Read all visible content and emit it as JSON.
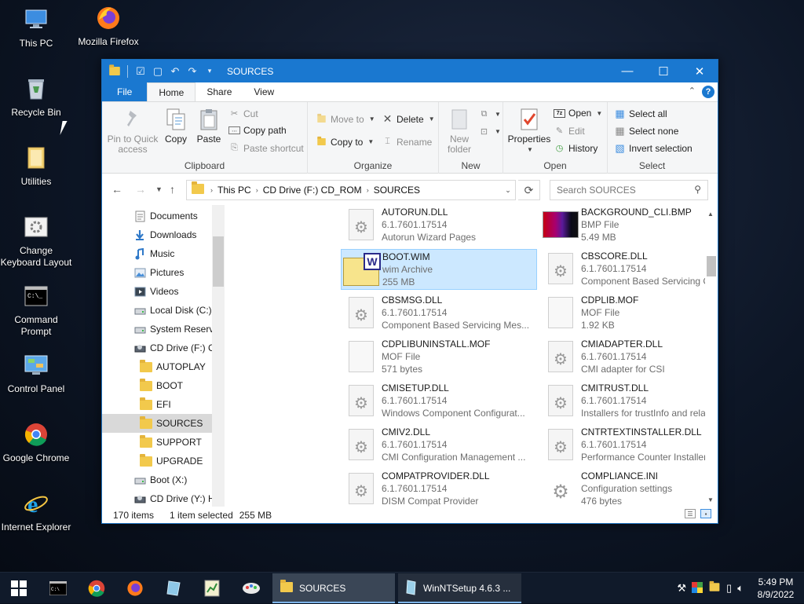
{
  "desktop": {
    "icons": [
      {
        "label": "This PC",
        "icon": "computer-icon"
      },
      {
        "label": "Mozilla Firefox",
        "icon": "firefox-icon"
      },
      {
        "label": "Recycle Bin",
        "icon": "recycle-bin-icon"
      },
      {
        "label": "Utilities",
        "icon": "folder-icon"
      },
      {
        "label": "Change Keyboard Layout",
        "icon": "keyboard-settings-icon"
      },
      {
        "label": "Command Prompt",
        "icon": "command-prompt-icon"
      },
      {
        "label": "Control Panel",
        "icon": "control-panel-icon"
      },
      {
        "label": "Google Chrome",
        "icon": "chrome-icon"
      },
      {
        "label": "Internet Explorer",
        "icon": "internet-explorer-icon"
      }
    ]
  },
  "window": {
    "title": "SOURCES",
    "controls": {
      "minimize": "—",
      "maximize": "☐",
      "close": "✕"
    },
    "tabs": [
      "File",
      "Home",
      "Share",
      "View"
    ],
    "active_tab": "Home"
  },
  "ribbon": {
    "clipboard": {
      "name": "Clipboard",
      "pin": "Pin to Quick access",
      "copy": "Copy",
      "paste": "Paste",
      "cut": "Cut",
      "copy_path": "Copy path",
      "paste_shortcut": "Paste shortcut"
    },
    "organize": {
      "name": "Organize",
      "move_to": "Move to",
      "copy_to": "Copy to",
      "delete": "Delete",
      "rename": "Rename"
    },
    "new": {
      "name": "New",
      "new_folder": "New folder"
    },
    "open": {
      "name": "Open",
      "properties": "Properties",
      "open": "Open",
      "edit": "Edit",
      "history": "History"
    },
    "select": {
      "name": "Select",
      "select_all": "Select all",
      "select_none": "Select none",
      "invert": "Invert selection"
    }
  },
  "address": {
    "crumbs": [
      "This PC",
      "CD Drive (F:) CD_ROM",
      "SOURCES"
    ],
    "search_placeholder": "Search SOURCES"
  },
  "nav": [
    {
      "label": "Documents",
      "icon": "documents-icon",
      "indent": 0
    },
    {
      "label": "Downloads",
      "icon": "downloads-icon",
      "indent": 0
    },
    {
      "label": "Music",
      "icon": "music-icon",
      "indent": 0
    },
    {
      "label": "Pictures",
      "icon": "pictures-icon",
      "indent": 0
    },
    {
      "label": "Videos",
      "icon": "videos-icon",
      "indent": 0
    },
    {
      "label": "Local Disk (C:)",
      "icon": "drive-icon",
      "indent": 0
    },
    {
      "label": "System Reserve",
      "icon": "drive-icon",
      "indent": 0
    },
    {
      "label": "CD Drive (F:) C",
      "icon": "cd-drive-icon",
      "indent": 0
    },
    {
      "label": "AUTOPLAY",
      "icon": "folder-icon",
      "indent": 1
    },
    {
      "label": "BOOT",
      "icon": "folder-icon",
      "indent": 1
    },
    {
      "label": "EFI",
      "icon": "folder-icon",
      "indent": 1
    },
    {
      "label": "SOURCES",
      "icon": "folder-icon",
      "indent": 1,
      "selected": true
    },
    {
      "label": "SUPPORT",
      "icon": "folder-icon",
      "indent": 1
    },
    {
      "label": "UPGRADE",
      "icon": "folder-icon",
      "indent": 1
    },
    {
      "label": "Boot (X:)",
      "icon": "drive-icon",
      "indent": 0
    },
    {
      "label": "CD Drive (Y:) H",
      "icon": "cd-drive-icon",
      "indent": 0
    }
  ],
  "files": [
    {
      "name": "AUTORUN.DLL",
      "l2": "6.1.7601.17514",
      "l3": "Autorun Wizard Pages",
      "icon": "dll-gear-icon"
    },
    {
      "name": "BACKGROUND_CLI.BMP",
      "l2": "BMP File",
      "l3": "5.49 MB",
      "icon": "bitmap-image-icon"
    },
    {
      "name": "BOOT.WIM",
      "l2": "wim Archive",
      "l3": "255 MB",
      "icon": "wim-archive-icon",
      "selected": true
    },
    {
      "name": "CBSCORE.DLL",
      "l2": "6.1.7601.17514",
      "l3": "Component Based Servicing Core...",
      "icon": "dll-gear-icon"
    },
    {
      "name": "CBSMSG.DLL",
      "l2": "6.1.7601.17514",
      "l3": "Component Based Servicing Mes...",
      "icon": "dll-gear-icon"
    },
    {
      "name": "CDPLIB.MOF",
      "l2": "MOF File",
      "l3": "1.92 KB",
      "icon": "file-icon"
    },
    {
      "name": "CDPLIBUNINSTALL.MOF",
      "l2": "MOF File",
      "l3": "571 bytes",
      "icon": "file-icon"
    },
    {
      "name": "CMIADAPTER.DLL",
      "l2": "6.1.7601.17514",
      "l3": "CMI adapter for CSI",
      "icon": "dll-gear-icon"
    },
    {
      "name": "CMISETUP.DLL",
      "l2": "6.1.7601.17514",
      "l3": "Windows Component Configurat...",
      "icon": "dll-gear-icon"
    },
    {
      "name": "CMITRUST.DLL",
      "l2": "6.1.7601.17514",
      "l3": "Installers for trustInfo and related ...",
      "icon": "dll-gear-icon"
    },
    {
      "name": "CMIV2.DLL",
      "l2": "6.1.7601.17514",
      "l3": "CMI Configuration Management ...",
      "icon": "dll-gear-icon"
    },
    {
      "name": "CNTRTEXTINSTALLER.DLL",
      "l2": "6.1.7601.17514",
      "l3": "Performance Counter Installer Plu...",
      "icon": "dll-gear-icon"
    },
    {
      "name": "COMPATPROVIDER.DLL",
      "l2": "6.1.7601.17514",
      "l3": "DISM Compat Provider",
      "icon": "dll-gear-icon"
    },
    {
      "name": "COMPLIANCE.INI",
      "l2": "Configuration settings",
      "l3": "476 bytes",
      "icon": "ini-settings-icon"
    }
  ],
  "status": {
    "count": "170 items",
    "selected": "1 item selected",
    "size": "255 MB"
  },
  "taskbar": {
    "windows": [
      {
        "label": "SOURCES",
        "icon": "folder-icon",
        "active": true
      },
      {
        "label": "WinNTSetup 4.6.3  ...",
        "icon": "winntsetup-icon",
        "active": false
      }
    ],
    "time": "5:49 PM",
    "date": "8/9/2022"
  },
  "colors": {
    "accent": "#1a78d0",
    "selection": "#cce8ff",
    "taskbar": "#101a2a"
  }
}
